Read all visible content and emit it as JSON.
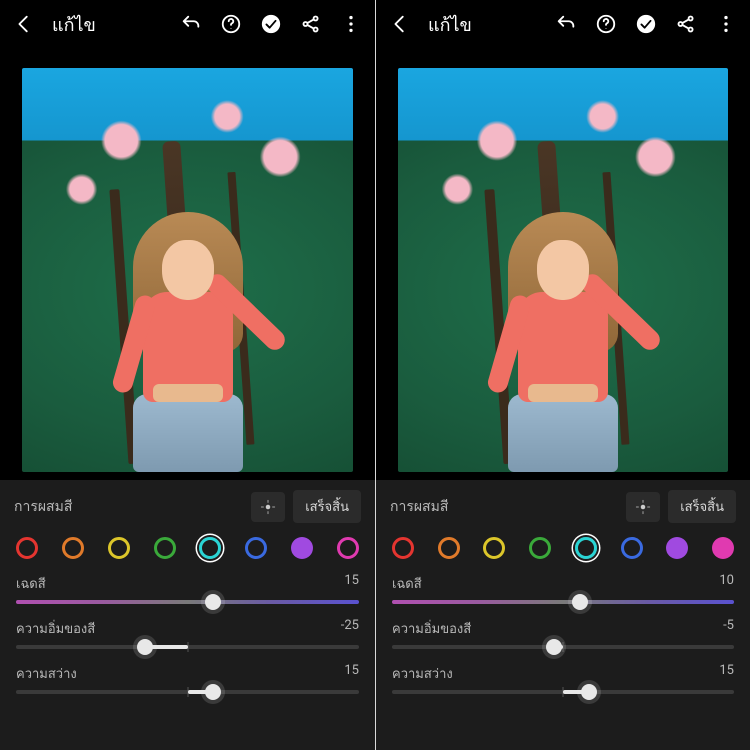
{
  "header": {
    "title": "แก้ไข"
  },
  "panelTitle": "การผสมสี",
  "doneLabel": "เสร็จสิ้น",
  "swatchColors": [
    "#e53530",
    "#e07a2a",
    "#dcc62a",
    "#3aa93a",
    "#2ad4d4",
    "#3a6ae0",
    "#a04ae0",
    "#e03ab0"
  ],
  "sliderNames": {
    "hue": "เฉดสี",
    "sat": "ความอิ่มของสี",
    "lum": "ความสว่าง"
  },
  "screens": [
    {
      "selectedSwatch": 4,
      "solidSwatches": [
        6
      ],
      "sliders": {
        "hue": 15,
        "sat": -25,
        "lum": 15
      }
    },
    {
      "selectedSwatch": 4,
      "solidSwatches": [
        6,
        7
      ],
      "sliders": {
        "hue": 10,
        "sat": -5,
        "lum": 15
      }
    }
  ]
}
